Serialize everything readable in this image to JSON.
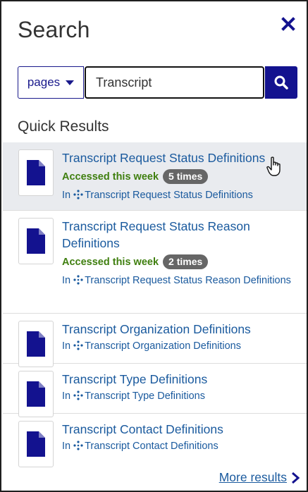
{
  "panel": {
    "title": "Search"
  },
  "search": {
    "scope_label": "pages",
    "query": "Transcript"
  },
  "quick_results": {
    "heading": "Quick Results",
    "items": [
      {
        "title": "Transcript Request Status Definitions",
        "accessed_label": "Accessed this week",
        "times": "5 times",
        "in_label": "In",
        "location": "Transcript Request Status Definitions",
        "hovered": true
      },
      {
        "title": "Transcript Request Status Reason Definitions",
        "accessed_label": "Accessed this week",
        "times": "2 times",
        "in_label": "In",
        "location": "Transcript Request Status Reason Definitions"
      },
      {
        "title": "Transcript Organization Definitions",
        "in_label": "In",
        "location": "Transcript Organization Definitions"
      },
      {
        "title": "Transcript Type Definitions",
        "in_label": "In",
        "location": "Transcript Type Definitions"
      },
      {
        "title": "Transcript Contact Definitions",
        "in_label": "In",
        "location": "Transcript Contact Definitions"
      }
    ]
  },
  "footer": {
    "more_label": "More results"
  },
  "icons": {
    "close": "close-icon",
    "caret": "chevron-down-icon",
    "search": "search-icon",
    "document": "document-icon",
    "space": "space-icon",
    "more": "chevron-right-icon"
  },
  "colors": {
    "brand": "#13128f",
    "link": "#1a5a9e",
    "accessed": "#3f7f0f",
    "badge": "#666666",
    "hover_row": "#e9ebef"
  }
}
